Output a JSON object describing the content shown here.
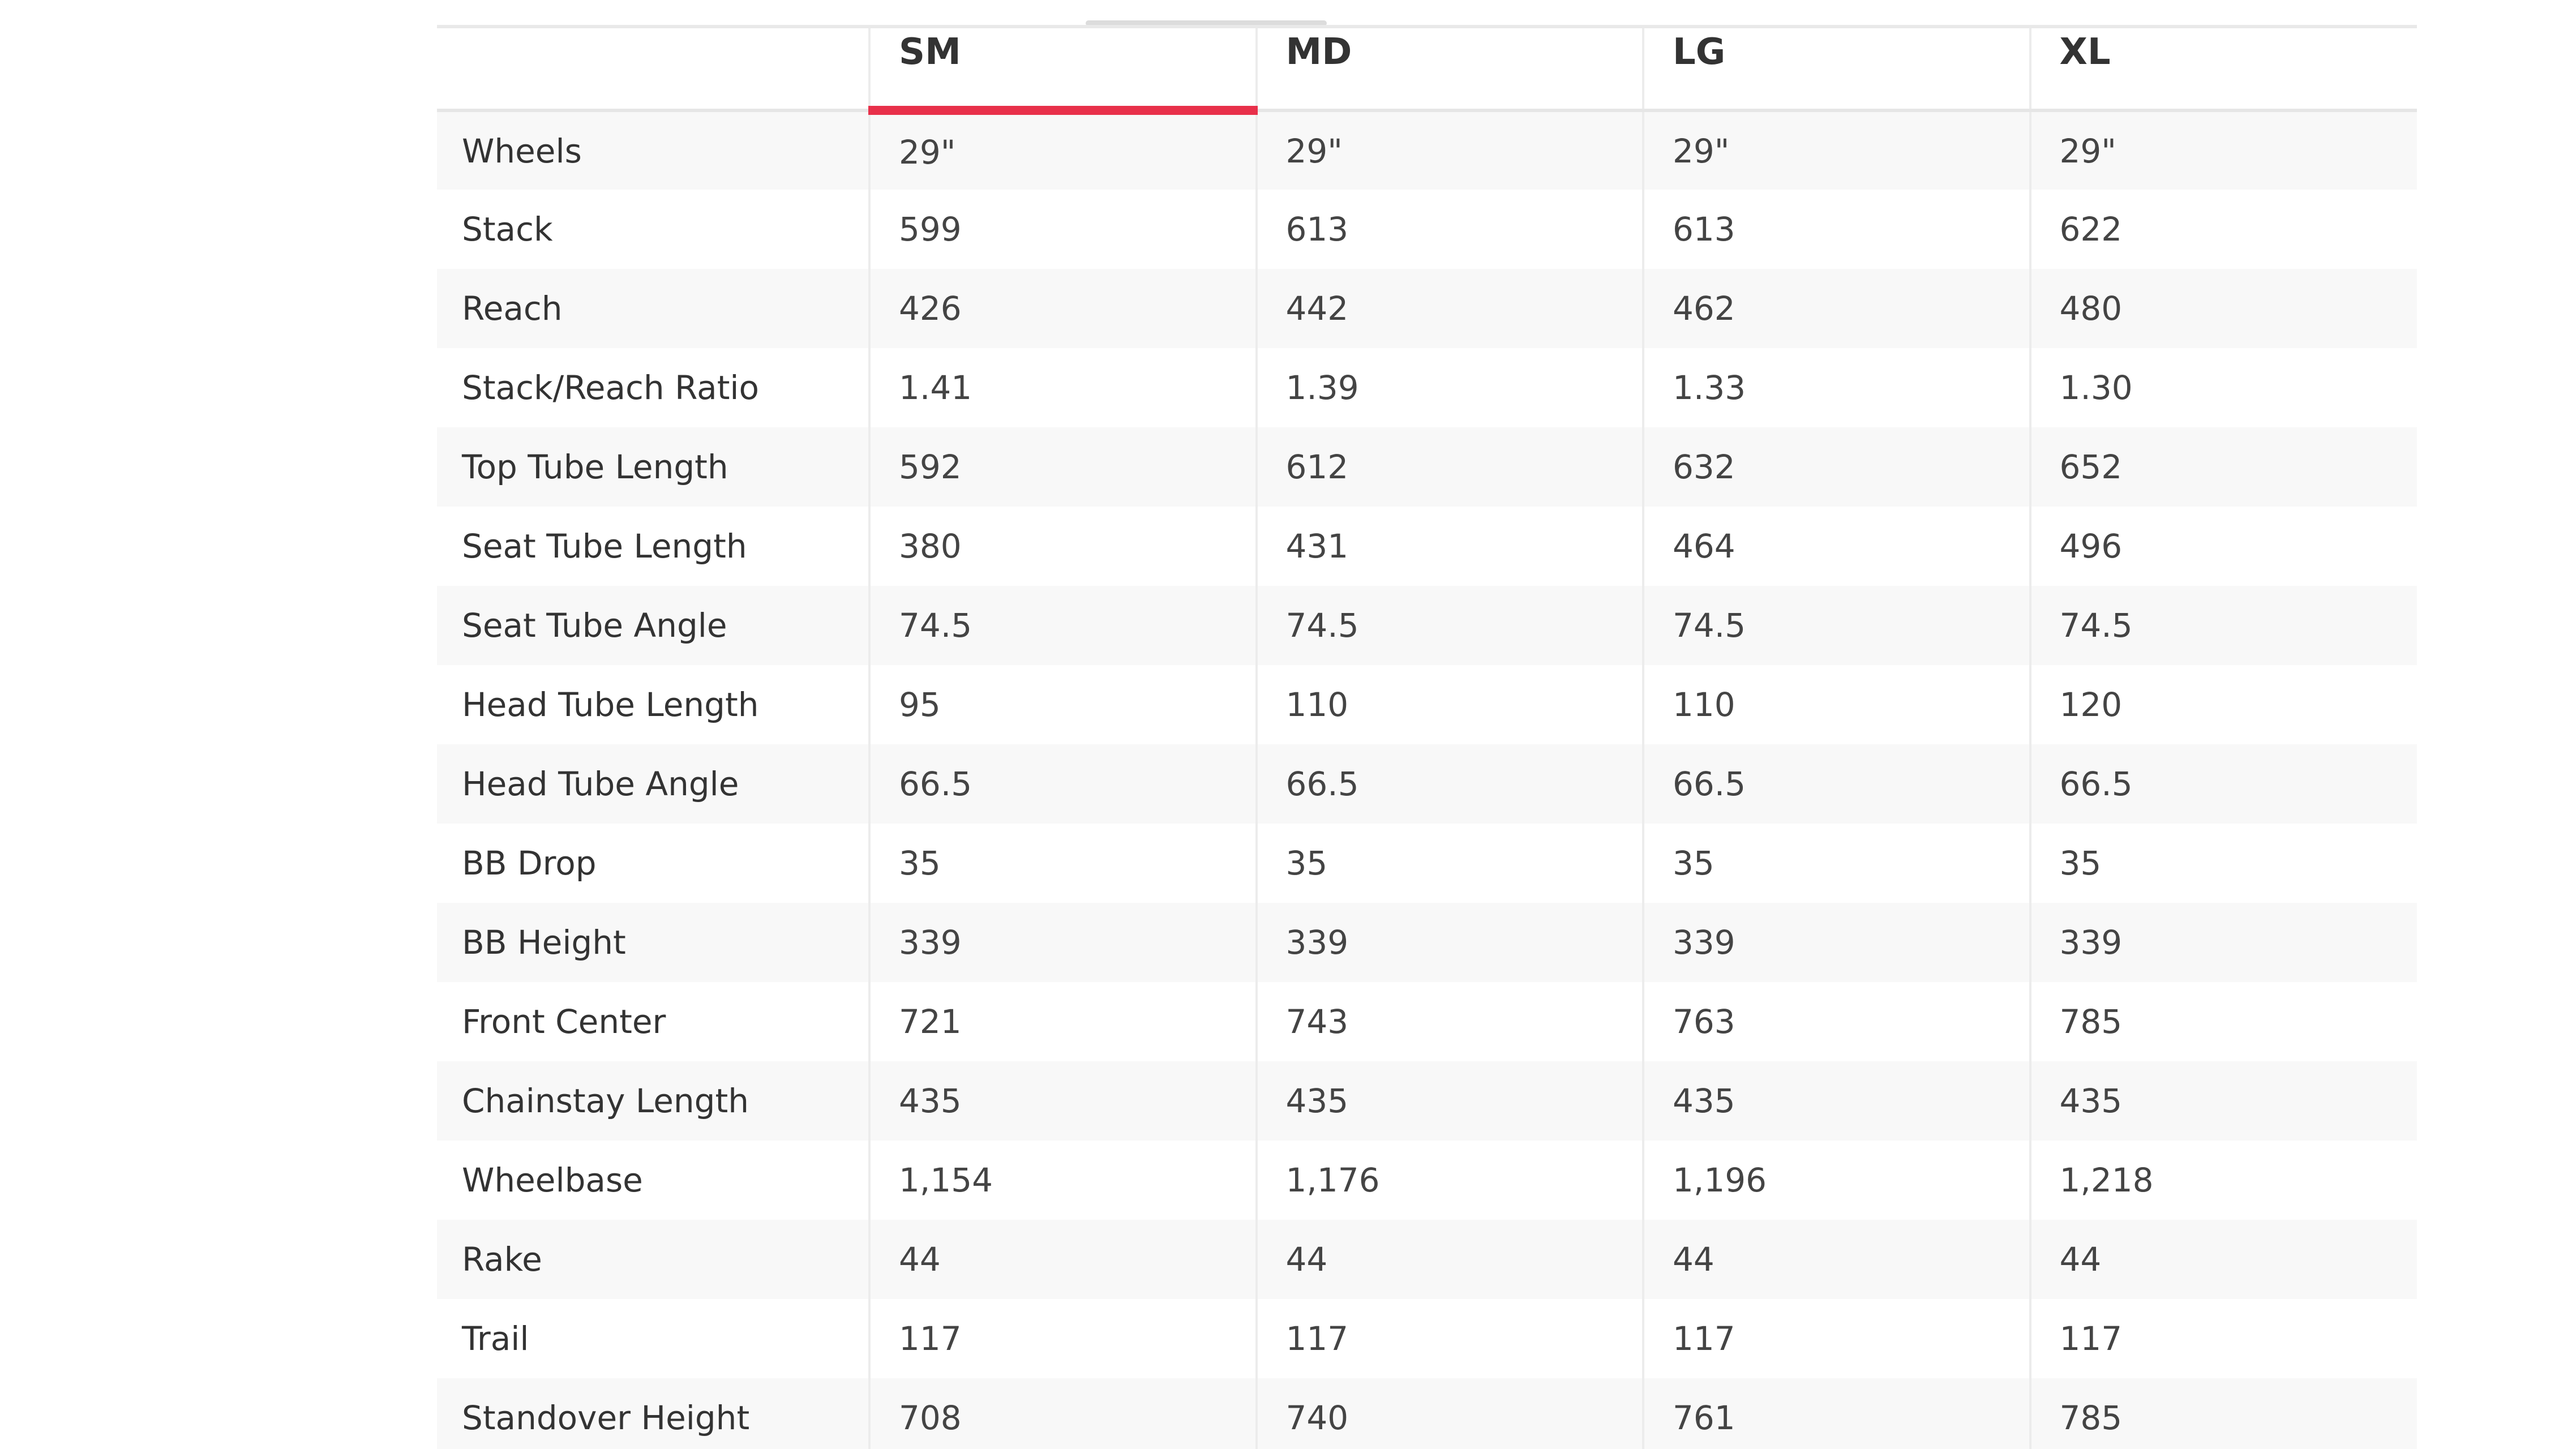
{
  "sizes": [
    {
      "id": "sm",
      "label": "SM",
      "active": true
    },
    {
      "id": "md",
      "label": "MD",
      "active": false
    },
    {
      "id": "lg",
      "label": "LG",
      "active": false
    },
    {
      "id": "xl",
      "label": "XL",
      "active": false
    }
  ],
  "accent_color": "#e8304a",
  "rows": [
    {
      "label": "Wheels",
      "values": [
        "29\"",
        "29\"",
        "29\"",
        "29\""
      ]
    },
    {
      "label": "Stack",
      "values": [
        "599",
        "613",
        "613",
        "622"
      ]
    },
    {
      "label": "Reach",
      "values": [
        "426",
        "442",
        "462",
        "480"
      ]
    },
    {
      "label": "Stack/Reach Ratio",
      "values": [
        "1.41",
        "1.39",
        "1.33",
        "1.30"
      ]
    },
    {
      "label": "Top Tube Length",
      "values": [
        "592",
        "612",
        "632",
        "652"
      ]
    },
    {
      "label": "Seat Tube Length",
      "values": [
        "380",
        "431",
        "464",
        "496"
      ]
    },
    {
      "label": "Seat Tube Angle",
      "values": [
        "74.5",
        "74.5",
        "74.5",
        "74.5"
      ]
    },
    {
      "label": "Head Tube Length",
      "values": [
        "95",
        "110",
        "110",
        "120"
      ]
    },
    {
      "label": "Head Tube Angle",
      "values": [
        "66.5",
        "66.5",
        "66.5",
        "66.5"
      ]
    },
    {
      "label": "BB Drop",
      "values": [
        "35",
        "35",
        "35",
        "35"
      ]
    },
    {
      "label": "BB Height",
      "values": [
        "339",
        "339",
        "339",
        "339"
      ]
    },
    {
      "label": "Front Center",
      "values": [
        "721",
        "743",
        "763",
        "785"
      ]
    },
    {
      "label": "Chainstay Length",
      "values": [
        "435",
        "435",
        "435",
        "435"
      ]
    },
    {
      "label": "Wheelbase",
      "values": [
        "1,154",
        "1,176",
        "1,196",
        "1,218"
      ]
    },
    {
      "label": "Rake",
      "values": [
        "44",
        "44",
        "44",
        "44"
      ]
    },
    {
      "label": "Trail",
      "values": [
        "117",
        "117",
        "117",
        "117"
      ]
    },
    {
      "label": "Standover Height",
      "values": [
        "708",
        "740",
        "761",
        "785"
      ]
    }
  ]
}
